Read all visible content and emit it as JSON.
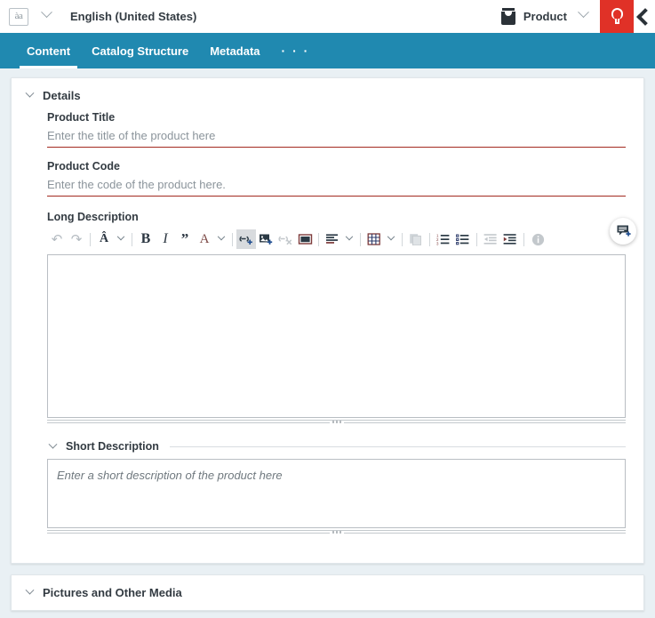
{
  "topbar": {
    "language_icon": "translate-icon",
    "language_label": "English (United States)",
    "language_caret": "chevron-down-icon",
    "product_icon": "product-icon",
    "product_label": "Product",
    "product_caret": "chevron-down-icon",
    "bulb_icon": "lightbulb-icon",
    "collapse_icon": "chevron-left-icon",
    "accent_red": "#e03127"
  },
  "tabs": {
    "items": [
      {
        "label": "Content",
        "active": true
      },
      {
        "label": "Catalog Structure",
        "active": false
      },
      {
        "label": "Metadata",
        "active": false
      }
    ],
    "more_label": "· · ·",
    "bar_color": "#2089b0"
  },
  "details": {
    "title": "Details",
    "caret": "chevron-down-icon",
    "product_title": {
      "label": "Product Title",
      "placeholder": "Enter the title of the product here",
      "value": "",
      "underline_color": "#a32a20"
    },
    "product_code": {
      "label": "Product Code",
      "placeholder": "Enter the code of the product here.",
      "value": "",
      "underline_color": "#a32a20"
    },
    "long_description": {
      "label": "Long Description",
      "value": "",
      "comment_button": "add-comment-icon",
      "toolbar": [
        {
          "name": "undo-icon",
          "glyph": "↶",
          "state": "disabled"
        },
        {
          "name": "redo-icon",
          "glyph": "↷",
          "state": "disabled"
        },
        {
          "name": "separator",
          "glyph": "",
          "state": "static"
        },
        {
          "name": "font-size-icon",
          "glyph": "A",
          "state": "normal"
        },
        {
          "name": "font-size-dropdown-icon",
          "glyph": "v",
          "state": "normal"
        },
        {
          "name": "separator",
          "glyph": "",
          "state": "static"
        },
        {
          "name": "bold-icon",
          "glyph": "B",
          "state": "normal"
        },
        {
          "name": "italic-icon",
          "glyph": "I",
          "state": "normal"
        },
        {
          "name": "blockquote-icon",
          "glyph": "”",
          "state": "normal"
        },
        {
          "name": "font-color-icon",
          "glyph": "A",
          "state": "normal"
        },
        {
          "name": "font-color-dropdown-icon",
          "glyph": "v",
          "state": "normal"
        },
        {
          "name": "separator",
          "glyph": "",
          "state": "static"
        },
        {
          "name": "insert-link-icon",
          "glyph": "",
          "state": "active"
        },
        {
          "name": "insert-image-icon",
          "glyph": "",
          "state": "normal"
        },
        {
          "name": "remove-link-icon",
          "glyph": "",
          "state": "disabled"
        },
        {
          "name": "insert-video-icon",
          "glyph": "",
          "state": "normal"
        },
        {
          "name": "separator",
          "glyph": "",
          "state": "static"
        },
        {
          "name": "align-icon",
          "glyph": "",
          "state": "normal"
        },
        {
          "name": "align-dropdown-icon",
          "glyph": "v",
          "state": "normal"
        },
        {
          "name": "separator",
          "glyph": "",
          "state": "static"
        },
        {
          "name": "table-icon",
          "glyph": "",
          "state": "normal"
        },
        {
          "name": "table-dropdown-icon",
          "glyph": "v",
          "state": "normal"
        },
        {
          "name": "separator",
          "glyph": "",
          "state": "static"
        },
        {
          "name": "paste-icon",
          "glyph": "",
          "state": "disabled"
        },
        {
          "name": "separator",
          "glyph": "",
          "state": "static"
        },
        {
          "name": "numbered-list-icon",
          "glyph": "",
          "state": "normal"
        },
        {
          "name": "bulleted-list-icon",
          "glyph": "",
          "state": "normal"
        },
        {
          "name": "separator",
          "glyph": "",
          "state": "static"
        },
        {
          "name": "outdent-icon",
          "glyph": "",
          "state": "disabled"
        },
        {
          "name": "indent-icon",
          "glyph": "",
          "state": "normal"
        },
        {
          "name": "separator",
          "glyph": "",
          "state": "static"
        },
        {
          "name": "info-icon",
          "glyph": "i",
          "state": "disabled"
        }
      ]
    },
    "short_description": {
      "title": "Short Description",
      "caret": "chevron-down-icon",
      "placeholder": "Enter a short description of the product here",
      "value": ""
    }
  },
  "media": {
    "title": "Pictures and Other Media",
    "caret": "chevron-down-icon"
  }
}
